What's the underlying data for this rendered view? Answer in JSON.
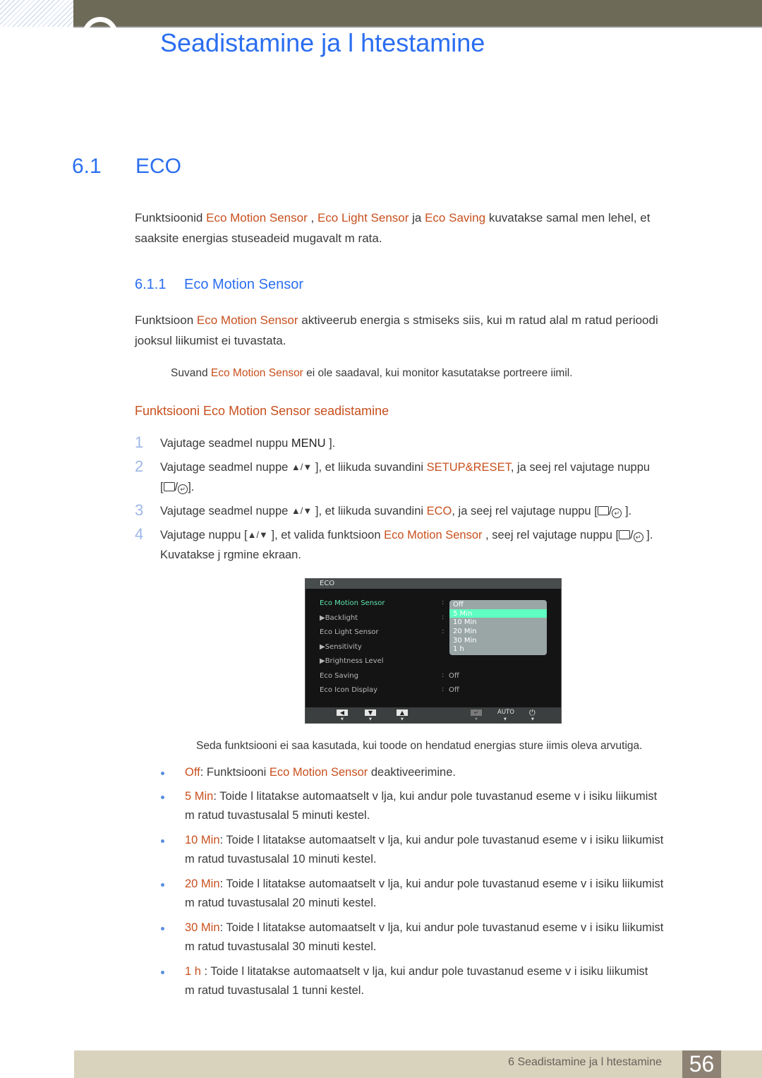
{
  "header": {
    "chapter_title": "Seadistamine ja l htestamine"
  },
  "section": {
    "number": "6.1",
    "title": "ECO",
    "intro": {
      "t1": "Funktsioonid ",
      "h1": "Eco Motion Sensor",
      "t2": " , ",
      "h2": "Eco Light Sensor",
      "t3": " ja  ",
      "h3": "Eco Saving",
      "t4": "  kuvatakse samal men  lehel, et",
      "line2": "saaksite energias  stuseadeid mugavalt m  rata."
    }
  },
  "subsection": {
    "number": "6.1.1",
    "title": "Eco Motion Sensor",
    "desc": {
      "t1": "Funktsioon ",
      "h1": "Eco Motion Sensor",
      "t2": "  aktiveerub energia s  stmiseks siis, kui m  ratud alal m  ratud perioodi",
      "line2": "jooksul liikumist ei tuvastata."
    },
    "note": {
      "t1": "Suvand ",
      "h1": "Eco Motion Sensor",
      "t2": "  ei ole saadaval, kui monitor kasutatakse portreere iimil."
    }
  },
  "procedure": {
    "title": "Funktsiooni Eco Motion Sensor seadistamine",
    "steps": [
      {
        "num": "1",
        "t1": "Vajutage seadmel nuppu ",
        "key": "MENU",
        "t2": "  ]."
      },
      {
        "num": "2",
        "t1": "Vajutage seadmel nuppe ",
        "t2": " ], et liikuda suvandini ",
        "h1": "SETUP&RESET",
        "t3": ", ja seej rel vajutage nuppu",
        "line2_pre": "[",
        "line2_post": "]."
      },
      {
        "num": "3",
        "t1": "Vajutage seadmel nuppe ",
        "t2": " ], et liikuda suvandini ",
        "h1": "ECO",
        "t3": ", ja seej rel vajutage nuppu [",
        "t4": " ]."
      },
      {
        "num": "4",
        "t1": "Vajutage nuppu [",
        "t2": " ], et valida funktsioon ",
        "h1": "Eco Motion Sensor",
        "t3": " , seej rel vajutage nuppu [",
        "t4": " ].",
        "line2": "Kuvatakse j rgmine ekraan."
      }
    ],
    "up_down_glyph": "▲/▼",
    "enter_glyph": "↵"
  },
  "osd": {
    "title": "ECO",
    "rows": [
      {
        "label": "Eco Motion Sensor",
        "colon": ":",
        "value": "",
        "active": true
      },
      {
        "label": "▶Backlight",
        "colon": ":",
        "value": ""
      },
      {
        "label": "Eco Light Sensor",
        "colon": ":",
        "value": ""
      },
      {
        "label": "▶Sensitivity",
        "colon": "",
        "value": ""
      },
      {
        "label": "▶Brightness Level",
        "colon": "",
        "value": ""
      },
      {
        "label": "Eco Saving",
        "colon": ":",
        "value": "Off"
      },
      {
        "label": "Eco Icon Display",
        "colon": ":",
        "value": "Off"
      }
    ],
    "dropdown_options": [
      "Off",
      "5 Min",
      "10 Min",
      "20 Min",
      "30 Min",
      "1 h"
    ],
    "dropdown_selected": "5 Min",
    "buttons": {
      "left": "◀",
      "down": "▼",
      "up": "▲",
      "enter": "↵",
      "auto": "AUTO",
      "power": "⏻",
      "tick": "▼"
    }
  },
  "warning": "Seda funktsiooni ei saa kasutada, kui toode on hendatud energias  sture iimis oleva arvutiga.",
  "options": [
    {
      "key": "Off",
      "t1": ": Funktsiooni ",
      "h1": "Eco Motion Sensor",
      "t2": "  deaktiveerimine."
    },
    {
      "key": "5 Min",
      "t1": ": Toide l litatakse automaatselt v lja, kui andur pole tuvastanud eseme v i isiku liikumist",
      "line2": "m  ratud tuvastusalal 5 minuti kestel."
    },
    {
      "key": "10 Min",
      "t1": ": Toide l litatakse automaatselt v lja, kui andur pole tuvastanud eseme v i isiku liikumist",
      "line2": "m  ratud tuvastusalal 10 minuti kestel."
    },
    {
      "key": "20 Min",
      "t1": ": Toide l litatakse automaatselt v lja, kui andur pole tuvastanud eseme v i isiku liikumist",
      "line2": "m  ratud tuvastusalal 20 minuti kestel."
    },
    {
      "key": "30 Min",
      "t1": ": Toide l litatakse automaatselt v lja, kui andur pole tuvastanud eseme v i isiku liikumist",
      "line2": "m  ratud tuvastusalal 30 minuti kestel."
    },
    {
      "key": "1 h",
      "t1": " : Toide l litatakse automaatselt v lja, kui andur pole tuvastanud eseme v i isiku liikumist",
      "line2": "m  ratud tuvastusalal 1 tunni kestel."
    }
  ],
  "footer": {
    "chapter": "6 Seadistamine ja l htestamine",
    "page": "56"
  },
  "colors": {
    "heading_blue": "#2b6ef0",
    "highlight_orange": "#c8501e",
    "topbar": "#6d6b58",
    "footer_bg": "#d9d2bd",
    "page_box": "#8e8275",
    "osd_active": "#5fe6b0"
  }
}
